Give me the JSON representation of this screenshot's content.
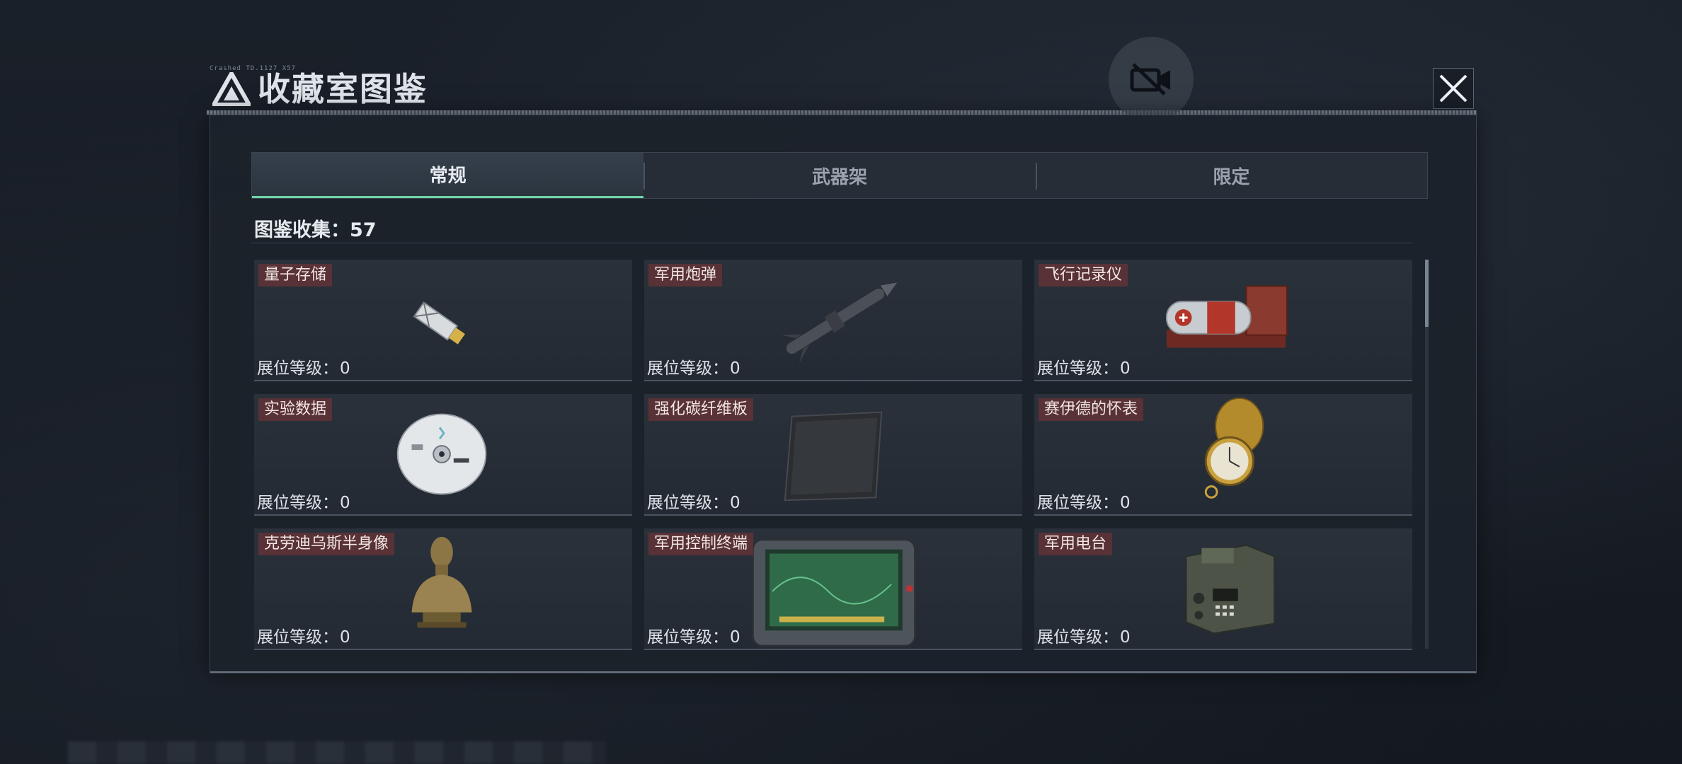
{
  "header": {
    "title": "收藏室图鉴",
    "deco_text": "Crashed TD.1127 X57"
  },
  "tabs": [
    {
      "label": "常规",
      "active": true
    },
    {
      "label": "武器架",
      "active": false
    },
    {
      "label": "限定",
      "active": false
    }
  ],
  "collection": {
    "text": "图鉴收集：57"
  },
  "level_label": "展位等级：",
  "items": [
    {
      "name": "量子存储",
      "level": "0",
      "icon": "usb-drive-icon"
    },
    {
      "name": "军用炮弹",
      "level": "0",
      "icon": "missile-icon"
    },
    {
      "name": "飞行记录仪",
      "level": "0",
      "icon": "flight-recorder-icon"
    },
    {
      "name": "实验数据",
      "level": "0",
      "icon": "disc-icon"
    },
    {
      "name": "强化碳纤维板",
      "level": "0",
      "icon": "carbon-plate-icon"
    },
    {
      "name": "赛伊德的怀表",
      "level": "0",
      "icon": "pocket-watch-icon"
    },
    {
      "name": "克劳迪乌斯半身像",
      "level": "0",
      "icon": "bust-icon"
    },
    {
      "name": "军用控制终端",
      "level": "0",
      "icon": "control-terminal-icon"
    },
    {
      "name": "军用电台",
      "level": "0",
      "icon": "radio-icon"
    }
  ],
  "colors": {
    "tab_active_accent": "#6fd3a6",
    "card_title_bg": "#783434",
    "panel_bg": "#1c222b"
  }
}
